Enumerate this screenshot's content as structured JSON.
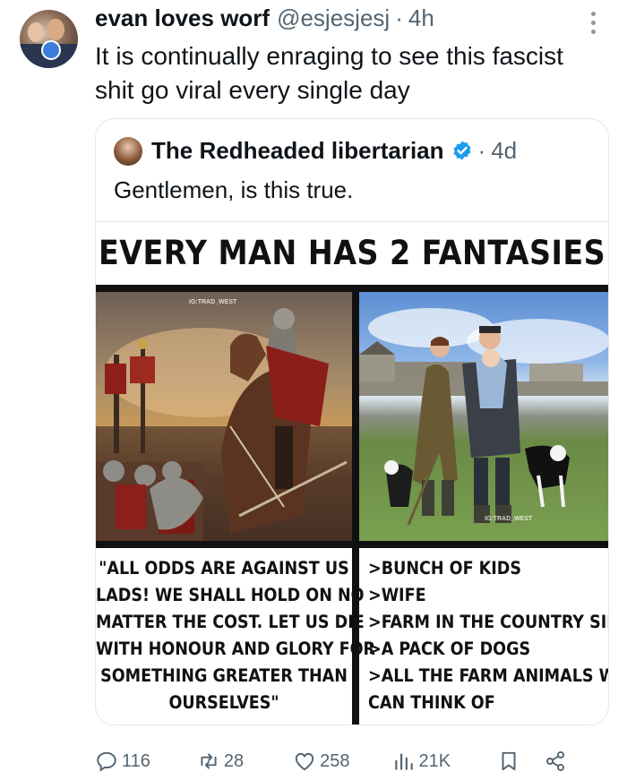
{
  "tweet": {
    "author_name": "evan loves worf",
    "handle": "@esjesjesj",
    "time": "4h",
    "text": "It is continually enraging to see this fascist shit go viral every single day"
  },
  "quoted": {
    "author_name": "The Redheaded libertarian",
    "time": "4d",
    "text": "Gentlemen, is this true.",
    "meme": {
      "title": "EVERY MAN HAS 2 FANTASIES",
      "watermark": "IG:TRAD_WEST",
      "left_caption": [
        "\"ALL ODDS ARE AGAINST US",
        "LADS! WE SHALL HOLD ON NO",
        "MATTER THE COST. LET US DIE",
        "WITH HONOUR AND GLORY FOR",
        "SOMETHING GREATER THAN",
        "OURSELVES\""
      ],
      "right_caption": [
        ">BUNCH OF KIDS",
        ">WIFE",
        ">FARM IN THE COUNTRY SIDE",
        ">A PACK OF DOGS",
        ">ALL THE FARM ANIMALS WE",
        "CAN THINK OF"
      ]
    }
  },
  "actions": {
    "replies": "116",
    "reposts": "28",
    "likes": "258",
    "views": "21K"
  },
  "colors": {
    "text": "#0f1419",
    "secondary": "#536471",
    "verified": "#1d9bf0",
    "border": "#e1e8ed"
  }
}
